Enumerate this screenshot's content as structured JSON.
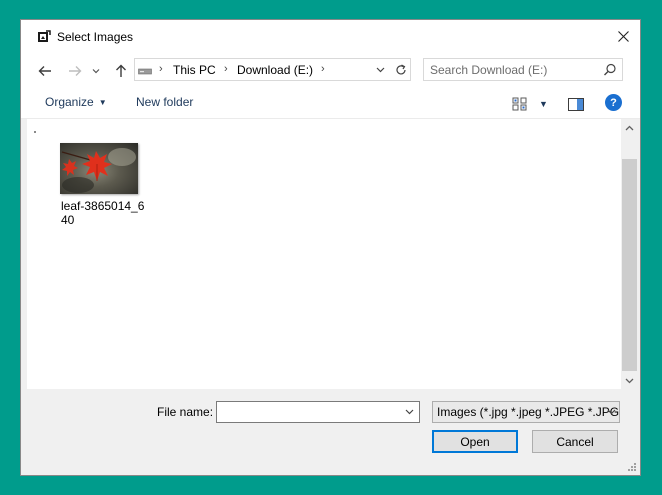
{
  "window": {
    "title": "Select Images",
    "close_glyph": "✕",
    "icon": "select-images-app-icon"
  },
  "nav": {
    "back_glyph": "←",
    "forward_glyph": "→",
    "recent_glyph": "⌄",
    "up_glyph": "↑",
    "breadcrumb": [
      "This PC",
      "Download (E:)"
    ],
    "separator": "›",
    "search_placeholder": "Search Download (E:)"
  },
  "toolbar": {
    "organize_label": "Organize",
    "new_folder_label": "New folder",
    "caret": "▼",
    "help_glyph": "?"
  },
  "files": [
    {
      "name": "leaf-3865014_640",
      "type": "image"
    }
  ],
  "bottom": {
    "file_name_label": "File name:",
    "file_name_value": "",
    "filter_value": "Images (*.jpg *.jpeg *.JPEG *.JPG)",
    "open_label": "Open",
    "cancel_label": "Cancel"
  },
  "colors": {
    "desktop": "#009c8c",
    "accent": "#0078d7",
    "help": "#1a6fd0",
    "link": "#1e395b"
  }
}
